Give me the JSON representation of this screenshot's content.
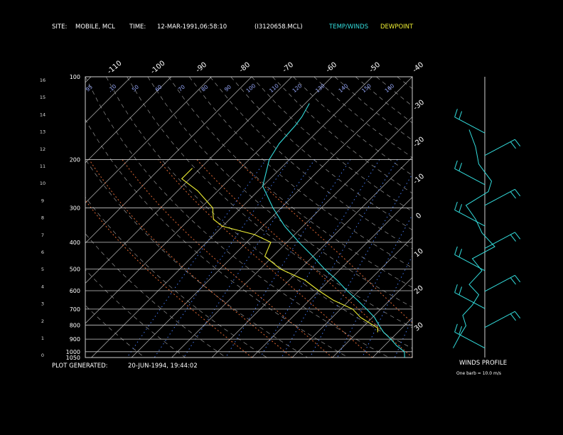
{
  "header": {
    "site_label": "SITE:",
    "site_value": "MOBILE, MCL",
    "time_label": "TIME:",
    "time_value": "12-MAR-1991,06:58:10",
    "file_name": "(I3120658.MCL)",
    "legend_temp": "TEMP/WINDS",
    "legend_dew": "DEWPOINT"
  },
  "footer": {
    "generated_label": "PLOT GENERATED:",
    "generated_value": "20-JUN-1994, 19:44:02",
    "winds_title": "WINDS PROFILE",
    "barb_note": "One barb = 10.0 m/s"
  },
  "colors": {
    "temp": "#33dddd",
    "dew": "#eeee33",
    "isobar": "#c8c8c8",
    "isotherm": "#b8b8b8",
    "mixing": "#4477ee",
    "dry_adiabat": "#aaaaaa",
    "moist_adiabat": "#dd6633",
    "mixing_label": "#99aaff",
    "moist_label": "#ff8855"
  },
  "chart_data": {
    "type": "line",
    "title": "",
    "pressure_levels": [
      {
        "p": 100,
        "label": "100"
      },
      {
        "p": 200,
        "label": "200"
      },
      {
        "p": 300,
        "label": "300"
      },
      {
        "p": 400,
        "label": "400"
      },
      {
        "p": 500,
        "label": "500"
      },
      {
        "p": 600,
        "label": "600"
      },
      {
        "p": 700,
        "label": "700"
      },
      {
        "p": 800,
        "label": "800"
      },
      {
        "p": 900,
        "label": "900"
      },
      {
        "p": 1000,
        "label": "1000"
      },
      {
        "p": 1050,
        "label": "1050"
      }
    ],
    "km_ticks": [
      "16",
      "15",
      "14",
      "13",
      "12",
      "11",
      "10",
      "9",
      "8",
      "7",
      "6",
      "5",
      "4",
      "3",
      "2",
      "1",
      "0"
    ],
    "isotherm_labels_top": [
      "-110",
      "-100",
      "-90",
      "-80",
      "-70",
      "-60",
      "-50",
      "-40"
    ],
    "isotherm_labels_right": [
      "-30",
      "-20",
      "-10",
      "0",
      "10",
      "20",
      "30"
    ],
    "mixing_ratio_labels": [
      {
        "p": 135,
        "labels": [
          "95",
          ".10",
          "50",
          "60",
          "70",
          "80",
          "90",
          "100",
          "110",
          "120",
          "130",
          "140",
          "150",
          "160"
        ]
      }
    ],
    "temperature_profile": [
      [
        1050,
        28
      ],
      [
        1000,
        26.5
      ],
      [
        950,
        23
      ],
      [
        900,
        20
      ],
      [
        850,
        16.5
      ],
      [
        800,
        13.5
      ],
      [
        750,
        10.5
      ],
      [
        700,
        6.5
      ],
      [
        650,
        2
      ],
      [
        600,
        -3
      ],
      [
        550,
        -8
      ],
      [
        500,
        -14
      ],
      [
        450,
        -20
      ],
      [
        400,
        -27
      ],
      [
        350,
        -34.5
      ],
      [
        300,
        -42
      ],
      [
        250,
        -50
      ],
      [
        200,
        -55
      ],
      [
        175,
        -56.5
      ],
      [
        150,
        -57
      ],
      [
        140,
        -57.5
      ],
      [
        125,
        -59
      ]
    ],
    "dewpoint_profile": [
      [
        850,
        15
      ],
      [
        820,
        14
      ],
      [
        800,
        12
      ],
      [
        750,
        7
      ],
      [
        700,
        3
      ],
      [
        650,
        -4
      ],
      [
        600,
        -10
      ],
      [
        550,
        -16
      ],
      [
        500,
        -25
      ],
      [
        450,
        -32
      ],
      [
        400,
        -34
      ],
      [
        375,
        -40
      ],
      [
        350,
        -50
      ],
      [
        330,
        -54
      ],
      [
        310,
        -56
      ],
      [
        300,
        -57
      ],
      [
        260,
        -65
      ],
      [
        235,
        -72
      ],
      [
        215,
        -72
      ]
    ],
    "wind_heights_km": [
      0.3,
      1.5,
      2.6,
      3.6,
      4.8,
      6.1,
      7.4,
      8.6,
      9.8,
      11.5,
      12.8
    ],
    "winds_profile": [
      [
        0.3,
        15
      ],
      [
        1.0,
        25
      ],
      [
        1.6,
        35
      ],
      [
        2.2,
        30
      ],
      [
        2.8,
        45
      ],
      [
        3.4,
        55
      ],
      [
        4.0,
        40
      ],
      [
        4.8,
        60
      ],
      [
        5.5,
        45
      ],
      [
        6.2,
        80
      ],
      [
        7.0,
        60
      ],
      [
        7.8,
        50
      ],
      [
        8.6,
        35
      ],
      [
        9.4,
        70
      ],
      [
        10.0,
        75
      ],
      [
        11.0,
        55
      ],
      [
        12.0,
        50
      ],
      [
        13.0,
        40
      ]
    ]
  }
}
